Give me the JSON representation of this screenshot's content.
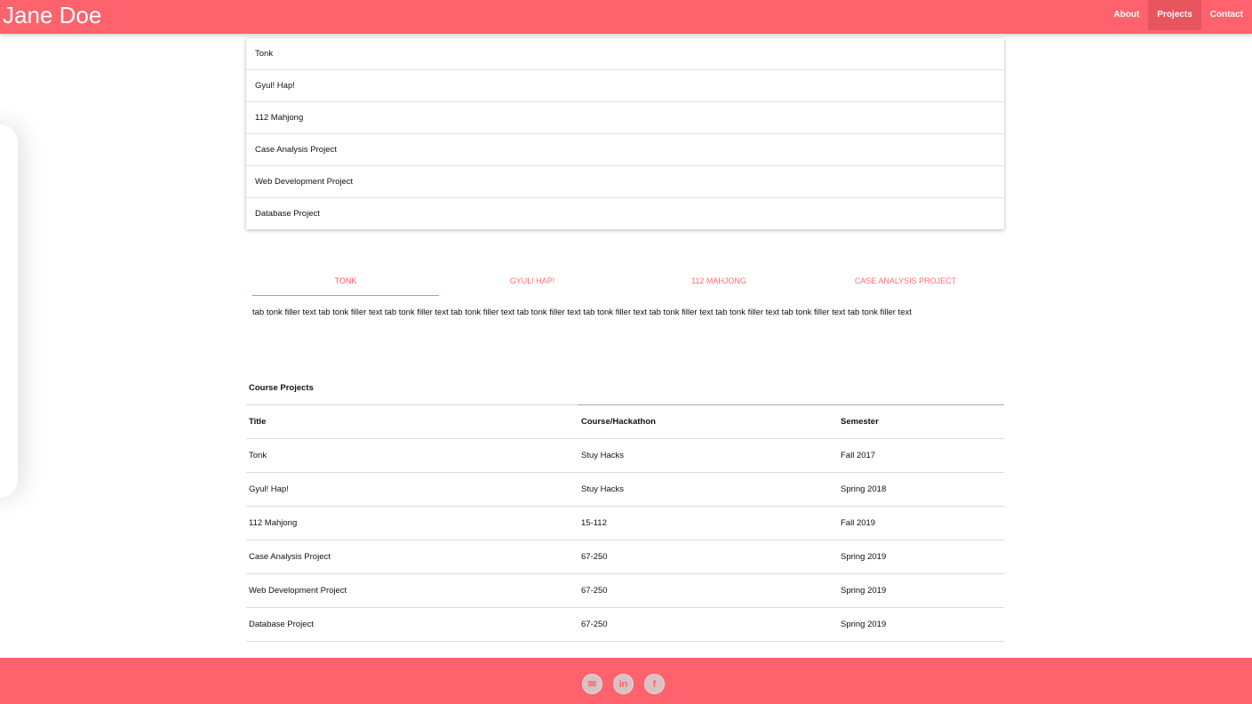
{
  "header": {
    "brand": "Jane Doe",
    "nav": [
      "About",
      "Projects",
      "Contact"
    ]
  },
  "collection": [
    "Tonk",
    "Gyul! Hap!",
    "112 Mahjong",
    "Case Analysis Project",
    "Web Development Project",
    "Database Project"
  ],
  "tabs": {
    "items": [
      "TONK",
      "GYUL! HAP!",
      "112 MAHJONG",
      "CASE ANALYSIS PROJECT"
    ],
    "active_index": 0,
    "content": "tab tonk filler text tab tonk filler text tab tonk filler text tab tonk filler text tab tonk filler text tab tonk filler text tab tonk filler text tab tonk filler text tab tonk filler text tab tonk filler text"
  },
  "table": {
    "caption": "Course Projects",
    "headers": [
      "Title",
      "Course/Hackathon",
      "Semester"
    ],
    "rows": [
      [
        "Tonk",
        "Stuy Hacks",
        "Fall 2017"
      ],
      [
        "Gyul! Hap!",
        "Stuy Hacks",
        "Spring 2018"
      ],
      [
        "112 Mahjong",
        "15-112",
        "Fall 2019"
      ],
      [
        "Case Analysis Project",
        "67-250",
        "Spring 2019"
      ],
      [
        "Web Development Project",
        "67-250",
        "Spring 2019"
      ],
      [
        "Database Project",
        "67-250",
        "Spring 2019"
      ]
    ]
  },
  "footer": {
    "icons": [
      "email-icon",
      "linkedin-icon",
      "facebook-icon"
    ],
    "icon_glyphs": [
      "✉",
      "in",
      "f"
    ]
  },
  "colors": {
    "accent": "#fe636d",
    "accent_dark": "#e8545e",
    "tab_text": "#fe6d78"
  }
}
